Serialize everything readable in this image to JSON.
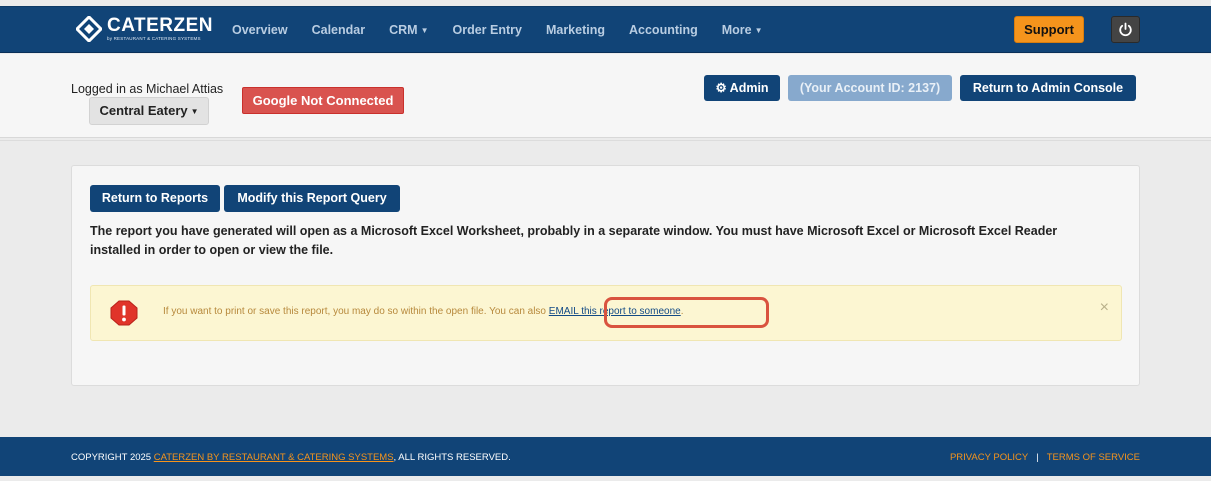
{
  "brand": {
    "name": "CATERZEN",
    "tagline": "by RESTAURANT & CATERING SYSTEMS"
  },
  "nav": {
    "items": [
      {
        "label": "Overview",
        "dropdown": false
      },
      {
        "label": "Calendar",
        "dropdown": false
      },
      {
        "label": "CRM",
        "dropdown": true
      },
      {
        "label": "Order Entry",
        "dropdown": false
      },
      {
        "label": "Marketing",
        "dropdown": false
      },
      {
        "label": "Accounting",
        "dropdown": false
      },
      {
        "label": "More",
        "dropdown": true
      }
    ],
    "support_label": "Support",
    "power_icon": "power-icon"
  },
  "account": {
    "logged_in_text": "Logged in as Michael Attias",
    "company_label": "Central Eatery",
    "google_label": "Google Not Connected",
    "admin_label": "Admin",
    "account_id_label": "(Your Account ID: 2137)",
    "return_admin_label": "Return to Admin Console"
  },
  "report": {
    "return_reports_label": "Return to Reports",
    "modify_query_label": "Modify this Report Query",
    "message": "The report you have generated will open as a Microsoft Excel Worksheet, probably in a separate window. You must have Microsoft Excel or Microsoft Excel Reader installed in order to open or view the file.",
    "alert_text": "If you want to print or save this report, you may do so within the open file. You can also ",
    "email_link": "EMAIL this report to someone",
    "alert_suffix": ".",
    "close_symbol": "×"
  },
  "footer": {
    "copyright_prefix": "COPYRIGHT 2025 ",
    "company_link": "CATERZEN BY RESTAURANT & CATERING SYSTEMS",
    "rights": ", ALL RIGHTS RESERVED.",
    "privacy": "PRIVACY POLICY",
    "separator": "|",
    "terms": "TERMS OF SERVICE"
  },
  "colors": {
    "navy": "#114477",
    "support_orange": "#f5941c",
    "danger_red": "#d9534f",
    "alert_bg": "#fcf6d2",
    "highlight": "#d9533f"
  }
}
